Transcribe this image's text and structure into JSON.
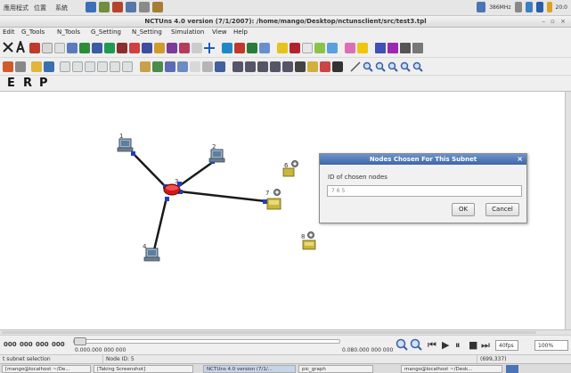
{
  "system_panel": {
    "menus": [
      "應用程式",
      "位置",
      "系統"
    ],
    "tray_text": "386MHz",
    "clock": "20:0"
  },
  "window": {
    "title": "NCTUns 4.0 version (7/1/2007): /home/mango/Desktop/nctunsclient/src/test3.tpl",
    "controls": "– ▫ ×"
  },
  "menubar": [
    "Edit",
    "G_Tools",
    "N_Tools",
    "G_Setting",
    "N_Setting",
    "Simulation",
    "View",
    "Help"
  ],
  "modes": [
    "E",
    "R",
    "P"
  ],
  "topology": {
    "node_labels": [
      "1",
      "2",
      "3",
      "4",
      "6",
      "7",
      "8"
    ],
    "icons": {
      "host": "computer-icon",
      "router": "router-icon",
      "mobile": "mobile-node-icon"
    },
    "colors": {
      "link": "#1a1a1a",
      "interface": "#1f3cc8",
      "router_body": "#d01818",
      "mobile_body": "#c9b63a"
    }
  },
  "dialog": {
    "title": "Nodes Chosen For This Subnet",
    "close": "×",
    "label": "ID of chosen nodes",
    "value": "7 6 5",
    "ok": "OK",
    "cancel": "Cancel"
  },
  "timebar": {
    "left_buttons": [
      "000",
      "000",
      "000",
      "000"
    ],
    "start_time": "0.000.000 000 000",
    "end_time": "0.080.000 000 000",
    "speed": "40fps",
    "zoom": "100%"
  },
  "status": {
    "mode": "t subnet selection",
    "node_id": "Node ID: 5",
    "coords": "(699,337)"
  },
  "taskbar": [
    "[mango@localhost ~/De...",
    "[Taking Screenshot]",
    "NCTUns 4.0 version (7/1/...",
    "pic_graph",
    "mango@localhost ~/Desk..."
  ]
}
